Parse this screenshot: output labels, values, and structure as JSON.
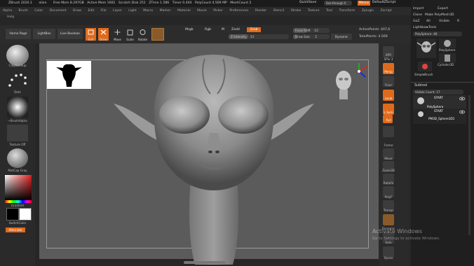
{
  "titlebar": {
    "items": [
      "ZBrush 2020.1",
      "alien",
      "Free Mem 8.297GB",
      "Active Mem 1602",
      "Scratch Disk 251",
      "ZTime 1.586",
      "Timer 0.404",
      "PolyCount 4.569 MP",
      "MeshCount 2"
    ],
    "quicksave": "QuickSave",
    "seethrough": "See-through 0",
    "menus": "Menus",
    "script": "DefaultZScript"
  },
  "menubar": {
    "items": [
      "Alpha",
      "Brush",
      "Color",
      "Document",
      "Draw",
      "Edit",
      "File",
      "Layer",
      "Light",
      "Macro",
      "Marker",
      "Material",
      "Movie",
      "Picker",
      "Preferences",
      "Render",
      "Stencil",
      "Stroke",
      "Texture",
      "Tool",
      "Transform",
      "Zplugin",
      "Zscript",
      "Help"
    ]
  },
  "toolbar": {
    "home_page": "Home Page",
    "lightbox": "LightBox",
    "live_boolean": "Live Boolean",
    "edit": "Edit",
    "draw": "Draw",
    "move": "Move",
    "scale": "Scale",
    "rotate": "Rotate",
    "mrgb": "Mrgb",
    "rgb": "Rgb",
    "m": "M",
    "zadd": "Zadd",
    "zsub": "Zsub",
    "z_intensity": "Z Intensity",
    "z_intensity_value": "33",
    "focal_shift": "Focal Shift",
    "focal_shift_value": "-12",
    "draw_size": "Draw Size",
    "draw_size_value": "2",
    "dynamic": "Dynamic",
    "active_points": "ActivePoints: 407,6",
    "total_points": "TotalPoints: 4.569"
  },
  "lefttray": {
    "brush_label": "ClayBuildup",
    "stroke_label": "Dots",
    "alpha_label": "~BrushAlpha",
    "texture_label": "Texture Off",
    "material_label": "MatCap Gray",
    "gradient_label": "Gradient",
    "switch_color": "SwitchColor",
    "alternate": "Alternate"
  },
  "righttray": {
    "labels": [
      "BPR",
      "SPix 3",
      "Persp",
      "Floor",
      "Local",
      "L.Sym",
      "Xyz",
      "Frame",
      "Move",
      "Zoom3D",
      "RotaFe",
      "PolyF",
      "Transp",
      "Dynamic",
      "Solo",
      "Xpose"
    ]
  },
  "rpanel": {
    "import": "Import",
    "export": "Export",
    "clone": "Clone",
    "make_polymesh": "Make PolyMesh3D",
    "goz": "GoZ",
    "all": "All",
    "visible": "Visible",
    "r": "R",
    "lightbox_tools": "Lightbox▸Tools",
    "polysphere_label": "PolySphere: 48",
    "polysphere": "PolySphere",
    "cylinder": "Cylinder3D",
    "simplebrush": "SimpleBrush",
    "subtool": "Subtool",
    "visible_count": "Visible Count: 17",
    "start1": "START",
    "polysphere_sub": "PolySphere",
    "start2": "START",
    "pm3d_sphere": "PM3D_Sphere3D1"
  },
  "watermark": {
    "title": "Activate Windows",
    "sub": "Go to Settings to activate Windows."
  },
  "colors": {
    "accent": "#e06a1c",
    "viewport": "#5b5b5b",
    "panel": "#1f1f1f"
  }
}
